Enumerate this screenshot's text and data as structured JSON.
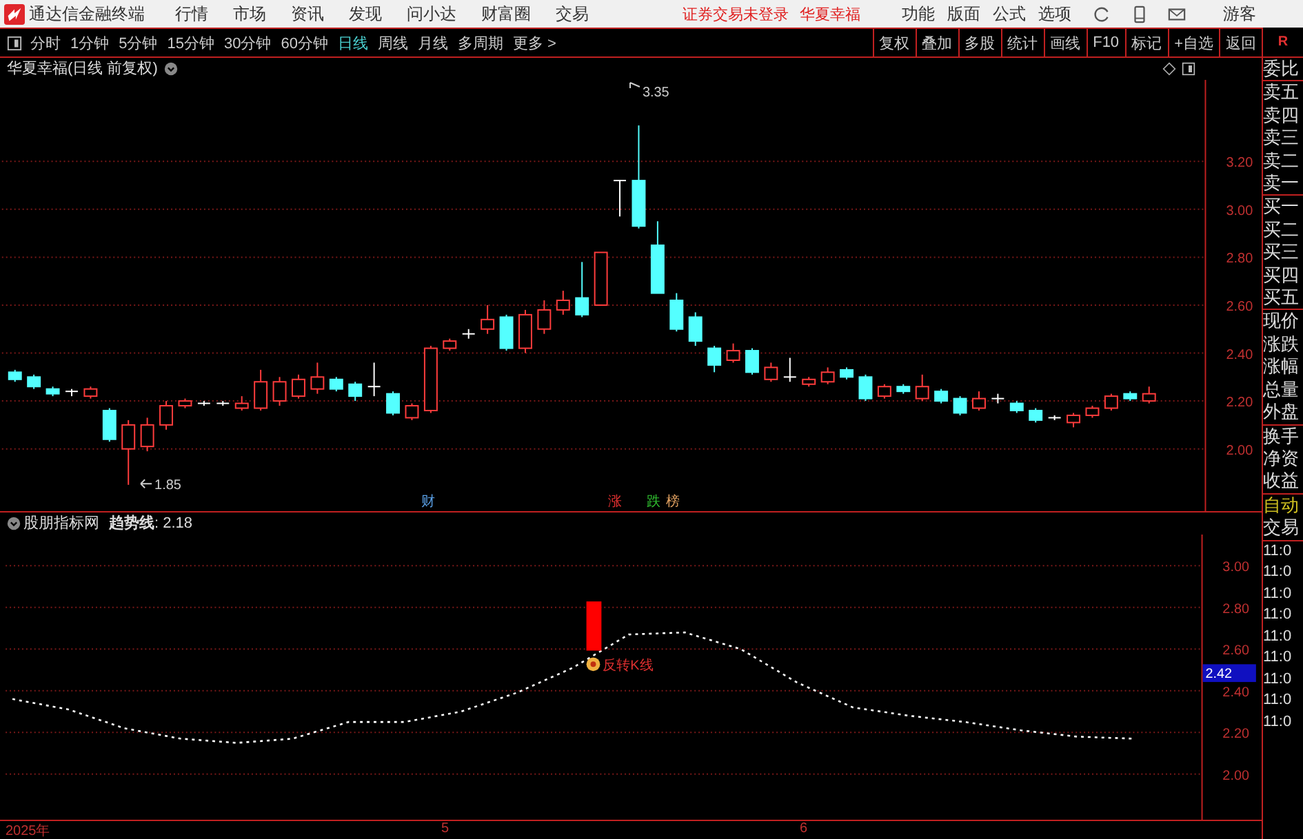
{
  "app_title": "通达信金融终端",
  "menu": [
    "行情",
    "市场",
    "资讯",
    "发现",
    "问小达",
    "财富圈",
    "交易"
  ],
  "login_notice": "证券交易未登录",
  "stock_name": "华夏幸福",
  "right_menu": [
    "功能",
    "版面",
    "公式",
    "选项"
  ],
  "user": "游客",
  "periods": [
    {
      "label": "分时",
      "selected": false
    },
    {
      "label": "1分钟",
      "selected": false
    },
    {
      "label": "5分钟",
      "selected": false
    },
    {
      "label": "15分钟",
      "selected": false
    },
    {
      "label": "30分钟",
      "selected": false
    },
    {
      "label": "60分钟",
      "selected": false
    },
    {
      "label": "日线",
      "selected": true
    },
    {
      "label": "周线",
      "selected": false
    },
    {
      "label": "月线",
      "selected": false
    },
    {
      "label": "多周期",
      "selected": false
    },
    {
      "label": "更多 >",
      "selected": false
    }
  ],
  "tools": [
    "复权",
    "叠加",
    "多股",
    "统计",
    "画线",
    "F10",
    "标记",
    "+自选",
    "返回"
  ],
  "chart": {
    "title": "华夏幸福(日线 前复权)",
    "high_label": "3.35",
    "low_label": "1.85",
    "chart_data": {
      "type": "candlestick",
      "grid": true,
      "ylim": [
        1.74,
        3.54
      ],
      "yticks": [
        {
          "value": 3.2,
          "label": "3.20"
        },
        {
          "value": 3.0,
          "label": "3.00"
        },
        {
          "value": 2.8,
          "label": "2.80"
        },
        {
          "value": 2.6,
          "label": "2.60"
        },
        {
          "value": 2.4,
          "label": "2.40"
        },
        {
          "value": 2.2,
          "label": "2.20"
        },
        {
          "value": 2.0,
          "label": "2.00"
        }
      ],
      "ohlc": [
        [
          2.32,
          2.33,
          2.28,
          2.29
        ],
        [
          2.3,
          2.31,
          2.25,
          2.26
        ],
        [
          2.25,
          2.26,
          2.22,
          2.23
        ],
        [
          2.24,
          2.25,
          2.22,
          2.24
        ],
        [
          2.22,
          2.26,
          2.21,
          2.25
        ],
        [
          2.16,
          2.17,
          2.03,
          2.04
        ],
        [
          2.0,
          2.12,
          1.85,
          2.1
        ],
        [
          2.01,
          2.13,
          1.99,
          2.1
        ],
        [
          2.1,
          2.2,
          2.08,
          2.18
        ],
        [
          2.18,
          2.21,
          2.17,
          2.2
        ],
        [
          2.19,
          2.2,
          2.18,
          2.19
        ],
        [
          2.19,
          2.2,
          2.18,
          2.19
        ],
        [
          2.17,
          2.22,
          2.16,
          2.19
        ],
        [
          2.17,
          2.33,
          2.16,
          2.28
        ],
        [
          2.2,
          2.3,
          2.18,
          2.28
        ],
        [
          2.22,
          2.31,
          2.21,
          2.29
        ],
        [
          2.25,
          2.36,
          2.23,
          2.3
        ],
        [
          2.29,
          2.3,
          2.24,
          2.25
        ],
        [
          2.27,
          2.28,
          2.2,
          2.22
        ],
        [
          2.26,
          2.36,
          2.22,
          2.26
        ],
        [
          2.23,
          2.24,
          2.14,
          2.15
        ],
        [
          2.13,
          2.19,
          2.12,
          2.18
        ],
        [
          2.16,
          2.43,
          2.15,
          2.42
        ],
        [
          2.42,
          2.46,
          2.41,
          2.45
        ],
        [
          2.48,
          2.5,
          2.46,
          2.48
        ],
        [
          2.5,
          2.6,
          2.48,
          2.54
        ],
        [
          2.55,
          2.56,
          2.41,
          2.42
        ],
        [
          2.42,
          2.58,
          2.4,
          2.56
        ],
        [
          2.5,
          2.62,
          2.48,
          2.58
        ],
        [
          2.58,
          2.66,
          2.56,
          2.62
        ],
        [
          2.63,
          2.78,
          2.55,
          2.56
        ],
        [
          2.6,
          2.82,
          2.6,
          2.82
        ],
        [
          3.12,
          3.12,
          2.97,
          3.12
        ],
        [
          3.12,
          3.35,
          2.92,
          2.93
        ],
        [
          2.85,
          2.95,
          2.65,
          2.65
        ],
        [
          2.62,
          2.65,
          2.49,
          2.5
        ],
        [
          2.55,
          2.57,
          2.43,
          2.45
        ],
        [
          2.42,
          2.43,
          2.32,
          2.35
        ],
        [
          2.37,
          2.44,
          2.36,
          2.41
        ],
        [
          2.41,
          2.42,
          2.31,
          2.32
        ],
        [
          2.29,
          2.36,
          2.28,
          2.34
        ],
        [
          2.3,
          2.38,
          2.28,
          2.3
        ],
        [
          2.27,
          2.3,
          2.26,
          2.29
        ],
        [
          2.28,
          2.34,
          2.27,
          2.32
        ],
        [
          2.33,
          2.34,
          2.29,
          2.3
        ],
        [
          2.3,
          2.31,
          2.2,
          2.21
        ],
        [
          2.22,
          2.27,
          2.21,
          2.26
        ],
        [
          2.26,
          2.27,
          2.23,
          2.24
        ],
        [
          2.21,
          2.31,
          2.2,
          2.26
        ],
        [
          2.24,
          2.25,
          2.19,
          2.2
        ],
        [
          2.21,
          2.22,
          2.14,
          2.15
        ],
        [
          2.17,
          2.24,
          2.16,
          2.21
        ],
        [
          2.21,
          2.23,
          2.19,
          2.21
        ],
        [
          2.19,
          2.2,
          2.15,
          2.16
        ],
        [
          2.16,
          2.17,
          2.11,
          2.12
        ],
        [
          2.13,
          2.14,
          2.12,
          2.13
        ],
        [
          2.11,
          2.15,
          2.09,
          2.14
        ],
        [
          2.14,
          2.18,
          2.13,
          2.17
        ],
        [
          2.17,
          2.23,
          2.16,
          2.22
        ],
        [
          2.23,
          2.24,
          2.2,
          2.21
        ],
        [
          2.2,
          2.26,
          2.19,
          2.23
        ]
      ]
    },
    "markers": [
      {
        "label": "财",
        "color": "#5aa0e6"
      },
      {
        "label": "涨",
        "color": "#e03030"
      },
      {
        "label": "跌",
        "color": "#30c030"
      },
      {
        "label": "榜",
        "color": "#e0a060"
      }
    ]
  },
  "indicator": {
    "name": "股朋指标网",
    "value": ": 2.18",
    "signal": "反转K线",
    "current": "2.42",
    "chart_data": {
      "type": "line",
      "grid": true,
      "ylim": [
        1.78,
        3.15
      ],
      "yticks": [
        {
          "value": 3.0,
          "label": "3.00"
        },
        {
          "value": 2.8,
          "label": "2.80"
        },
        {
          "value": 2.6,
          "label": "2.60"
        },
        {
          "value": 2.4,
          "label": "2.40"
        },
        {
          "value": 2.2,
          "label": "2.20"
        },
        {
          "value": 2.0,
          "label": "2.00"
        }
      ],
      "series": [
        {
          "name": "趋势线",
          "color": "#ffffff",
          "line_style": "dashed",
          "values": [
            2.36,
            2.31,
            2.22,
            2.17,
            2.15,
            2.17,
            2.25,
            2.25,
            2.3,
            2.39,
            2.51,
            2.67,
            2.68,
            2.6,
            2.44,
            2.32,
            2.28,
            2.25,
            2.21,
            2.18,
            2.17
          ]
        }
      ]
    }
  },
  "time_axis": [
    "2025年",
    "5",
    "6"
  ],
  "quote_panel": {
    "corner": "R",
    "groups": [
      [
        "委比"
      ],
      [
        "卖五",
        "卖四",
        "卖三",
        "卖二",
        "卖一"
      ],
      [
        "买一",
        "买二",
        "买三",
        "买四",
        "买五"
      ],
      [
        "现价",
        "涨跌",
        "涨幅",
        "总量",
        "外盘"
      ],
      [
        "换手",
        "净资",
        "收益"
      ]
    ],
    "auto": "自动",
    "trade": "交易",
    "times": [
      "11:0",
      "11:0",
      "11:0",
      "11:0",
      "11:0",
      "11:0",
      "11:0",
      "11:0",
      "11:0"
    ]
  }
}
